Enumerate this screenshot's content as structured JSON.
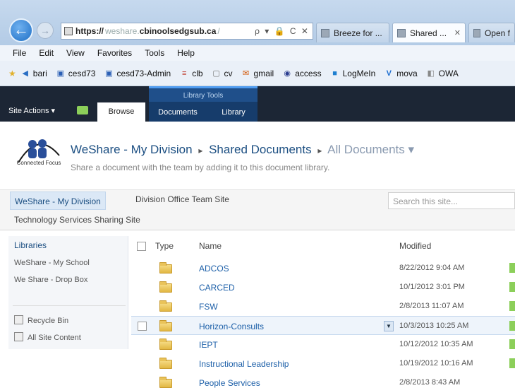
{
  "browser": {
    "back_glyph": "←",
    "forward_glyph": "→",
    "address": {
      "scheme": "https://",
      "prefix": "weshare.",
      "host": "cbinoolsedgsub.ca",
      "suffix": "/",
      "tools": "ρ ▾ 🔒 C ✕"
    },
    "tabs": [
      {
        "label": "Breeze for ...",
        "close": ""
      },
      {
        "label": "Shared ...",
        "close": "✕"
      },
      {
        "label": "Open f",
        "close": ""
      }
    ]
  },
  "menu": [
    "File",
    "Edit",
    "View",
    "Favorites",
    "Tools",
    "Help"
  ],
  "favorites": [
    {
      "label": "bari",
      "icon": "arrow-icon",
      "glyph": "◀",
      "color": "#2b6fc4"
    },
    {
      "label": "cesd73",
      "icon": "page-icon",
      "glyph": "▣",
      "color": "#2b5fb5"
    },
    {
      "label": "cesd73-Admin",
      "icon": "page-icon",
      "glyph": "▣",
      "color": "#2b5fb5"
    },
    {
      "label": "clb",
      "icon": "flag-icon",
      "glyph": "≡",
      "color": "#c0392b"
    },
    {
      "label": "cv",
      "icon": "document-icon",
      "glyph": "▢",
      "color": "#777777"
    },
    {
      "label": "gmail",
      "icon": "mail-icon",
      "glyph": "✉",
      "color": "#d35400"
    },
    {
      "label": "access",
      "icon": "globe-icon",
      "glyph": "◉",
      "color": "#2c3e90"
    },
    {
      "label": "LogMeIn",
      "icon": "logmein-icon",
      "glyph": "■",
      "color": "#1f7fd0"
    },
    {
      "label": "mova",
      "icon": "v-icon",
      "glyph": "V",
      "color": "#1f6fd0"
    },
    {
      "label": "OWA",
      "icon": "owa-icon",
      "glyph": "◧",
      "color": "#888888"
    }
  ],
  "ribbon": {
    "context_label": "Library Tools",
    "site_actions": "Site Actions ▾",
    "tabs": [
      "Browse",
      "Documents",
      "Library"
    ]
  },
  "title_area": {
    "logo_text": "Connected Focus",
    "crumbs": [
      "WeShare - My Division",
      "Shared Documents",
      "All Documents"
    ],
    "crumb_separator": "▸",
    "last_suffix": " ▾",
    "description": "Share a document with the team by adding it to this document library."
  },
  "top_nav": {
    "home": "WeShare - My Division",
    "office": "Division Office Team Site",
    "tech": "Technology Services Sharing Site",
    "search_placeholder": "Search this site..."
  },
  "quick_launch": {
    "heading": "Libraries",
    "items": [
      "WeShare - My School",
      "We Share - Drop Box"
    ],
    "recycle": "Recycle Bin",
    "all_content": "All Site Content"
  },
  "list": {
    "headers": {
      "type": "Type",
      "name": "Name",
      "modified": "Modified"
    },
    "rows": [
      {
        "name": "ADCOS",
        "modified": "8/22/2012 9:04 AM"
      },
      {
        "name": "CARCED",
        "modified": "10/1/2012 3:01 PM"
      },
      {
        "name": "FSW",
        "modified": "2/8/2013 11:07 AM"
      },
      {
        "name": "Horizon-Consults",
        "modified": "10/3/2013 10:25 AM",
        "selected": true
      },
      {
        "name": "IEPT",
        "modified": "10/12/2012 10:35 AM"
      },
      {
        "name": "Instructional Leadership",
        "modified": "10/19/2012 10:16 AM"
      },
      {
        "name": "People Services",
        "modified": "2/8/2013 8:43 AM"
      }
    ]
  }
}
